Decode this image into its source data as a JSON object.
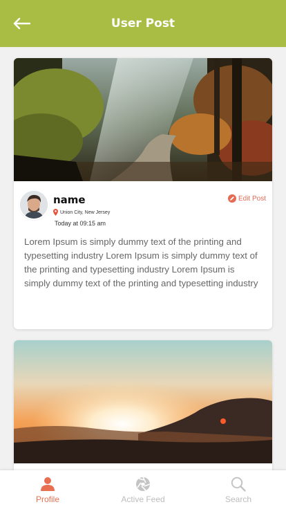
{
  "appbar": {
    "title": "User Post",
    "back_icon": "arrow-left-icon"
  },
  "posts": [
    {
      "author": "name",
      "location": "Union City, New Jersey",
      "time": "Today at 09:15 am",
      "edit_label": "Edit Post",
      "body": "Lorem Ipsum is simply dummy text of the printing and typesetting industry Lorem Ipsum is simply dummy text of the printing and typesetting industry Lorem Ipsum is simply dummy text of the printing and typesetting industry"
    },
    {}
  ],
  "bottom_nav": {
    "items": [
      {
        "label": "Profile",
        "icon": "person-icon",
        "active": true
      },
      {
        "label": "Active Feed",
        "icon": "aperture-icon",
        "active": false
      },
      {
        "label": "Search",
        "icon": "search-icon",
        "active": false
      }
    ]
  },
  "colors": {
    "appbar": "#a9bd45",
    "accent": "#e96f52",
    "inactive": "#bdbdbd",
    "body_text": "#666666"
  }
}
